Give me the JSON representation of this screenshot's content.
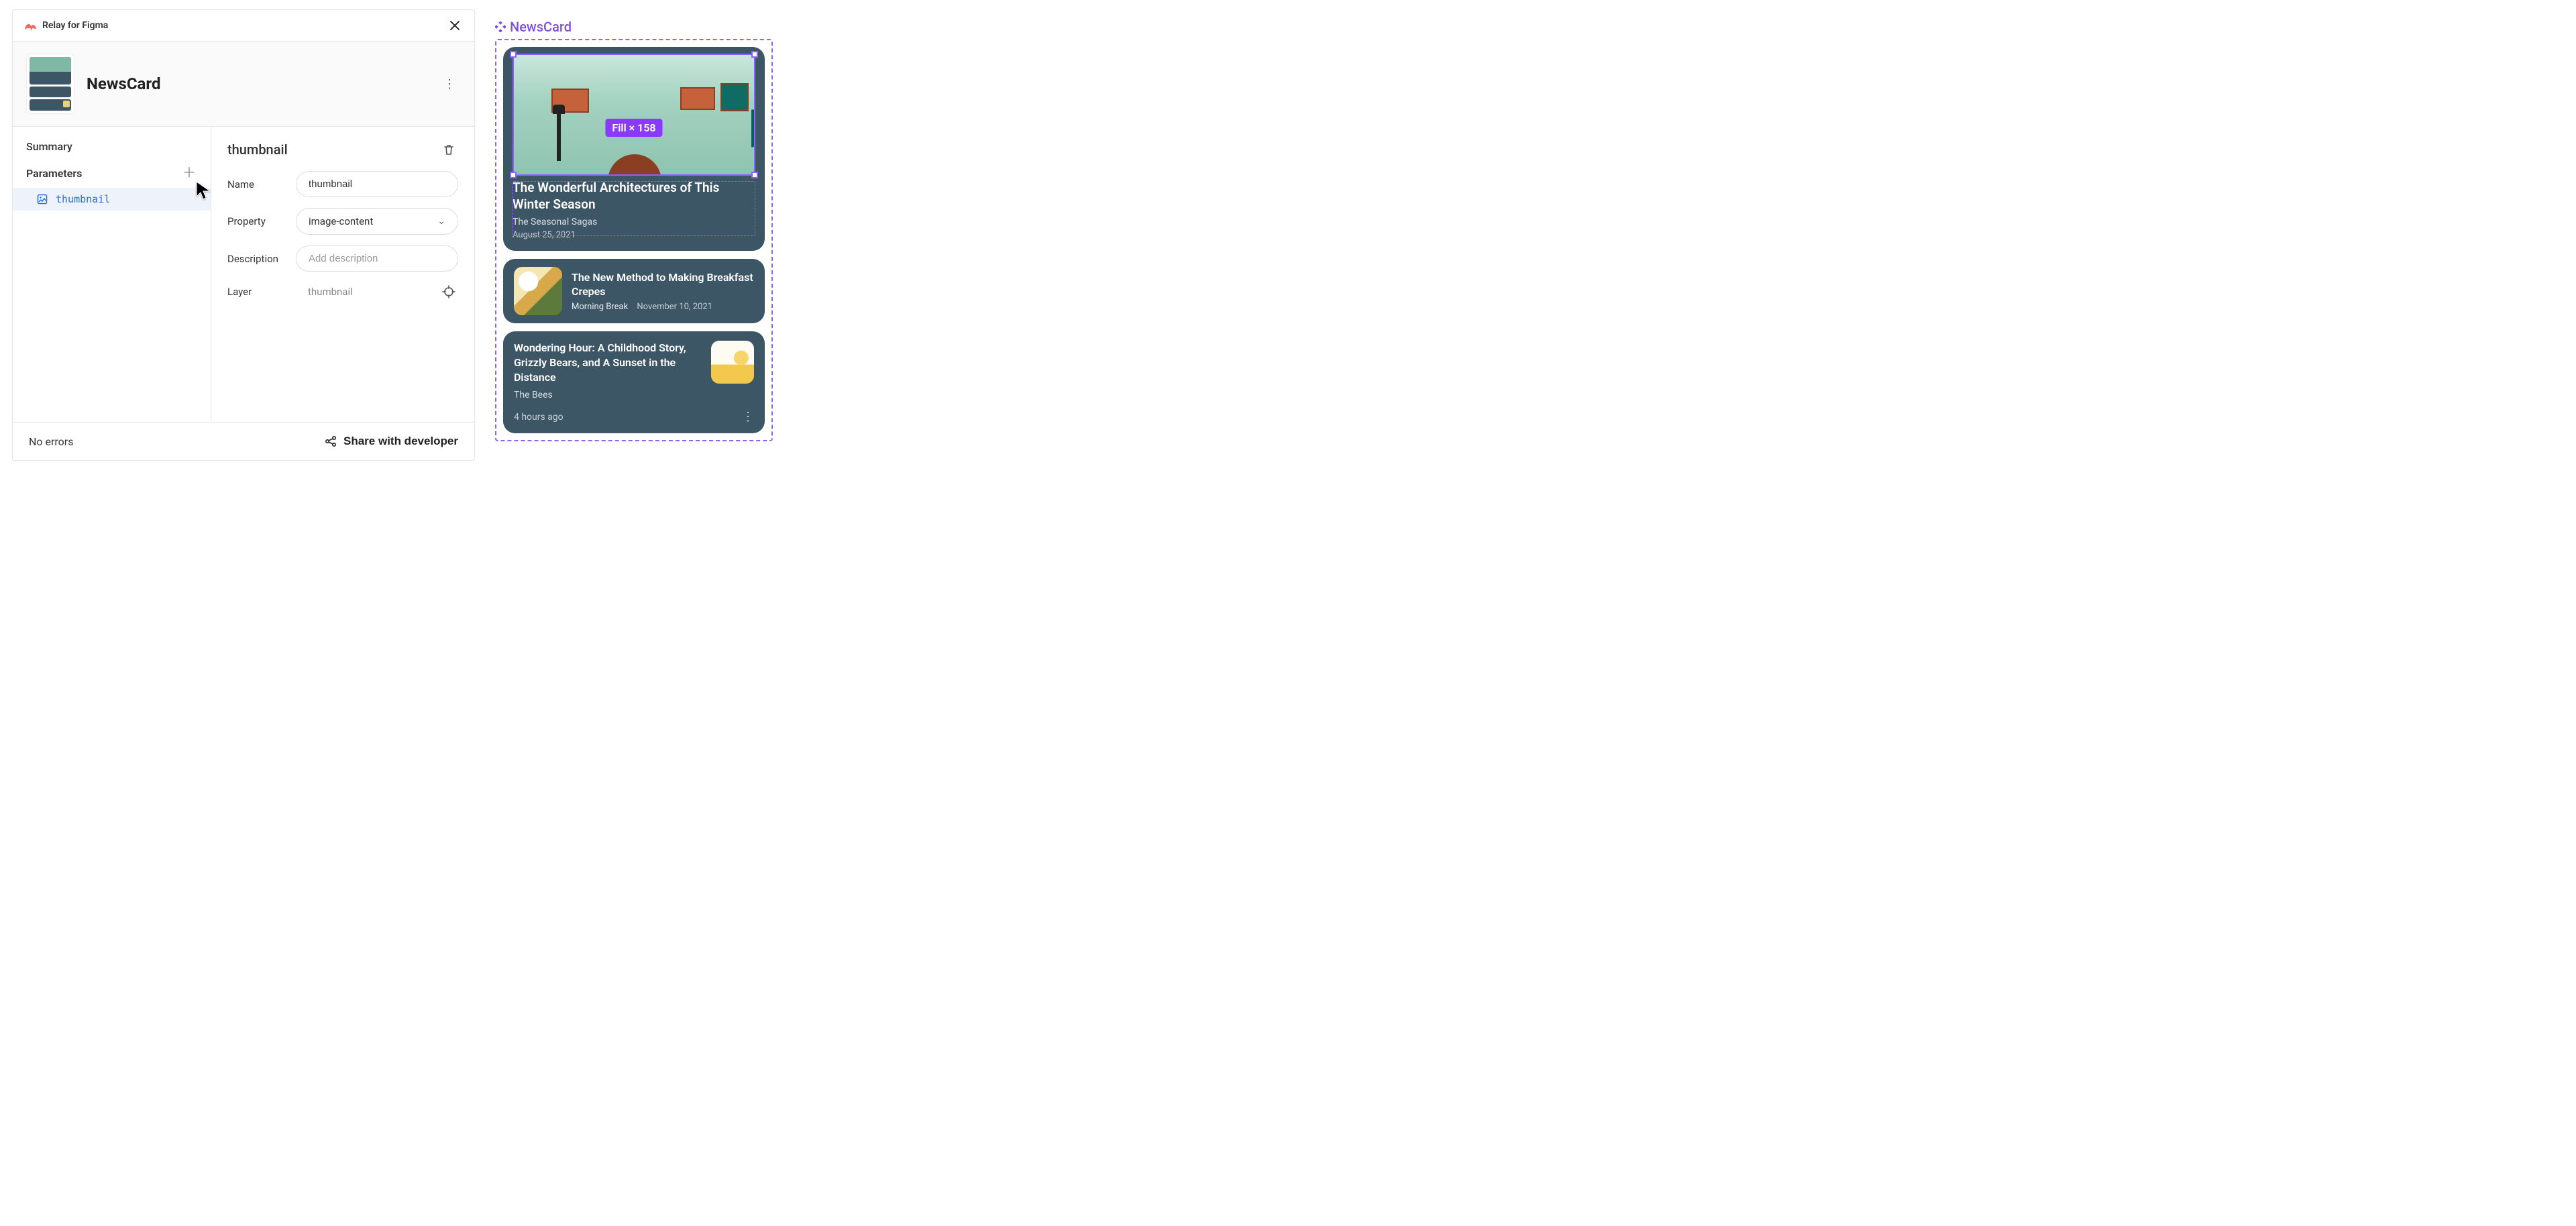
{
  "plugin": {
    "title": "Relay for Figma"
  },
  "component": {
    "name": "NewsCard"
  },
  "sidebar": {
    "summary_label": "Summary",
    "parameters_label": "Parameters",
    "items": [
      {
        "label": "thumbnail"
      }
    ]
  },
  "editor": {
    "heading": "thumbnail",
    "fields": {
      "name_label": "Name",
      "name_value": "thumbnail",
      "property_label": "Property",
      "property_value": "image-content",
      "description_label": "Description",
      "description_placeholder": "Add description",
      "layer_label": "Layer",
      "layer_value": "thumbnail"
    }
  },
  "footer": {
    "status": "No errors",
    "share_label": "Share with developer"
  },
  "canvas": {
    "component_label": "NewsCard",
    "selection_badge": "Fill × 158",
    "cards": [
      {
        "title": "The Wonderful Architectures of This Winter Season",
        "subtitle": "The Seasonal Sagas",
        "date": "August 25, 2021"
      },
      {
        "title": "The New Method to Making Breakfast Crepes",
        "source": "Morning Break",
        "date": "November 10, 2021"
      },
      {
        "title": "Wondering Hour: A Childhood Story, Grizzly Bears, and A Sunset in the Distance",
        "source": "The Bees",
        "time": "4 hours ago"
      }
    ]
  }
}
